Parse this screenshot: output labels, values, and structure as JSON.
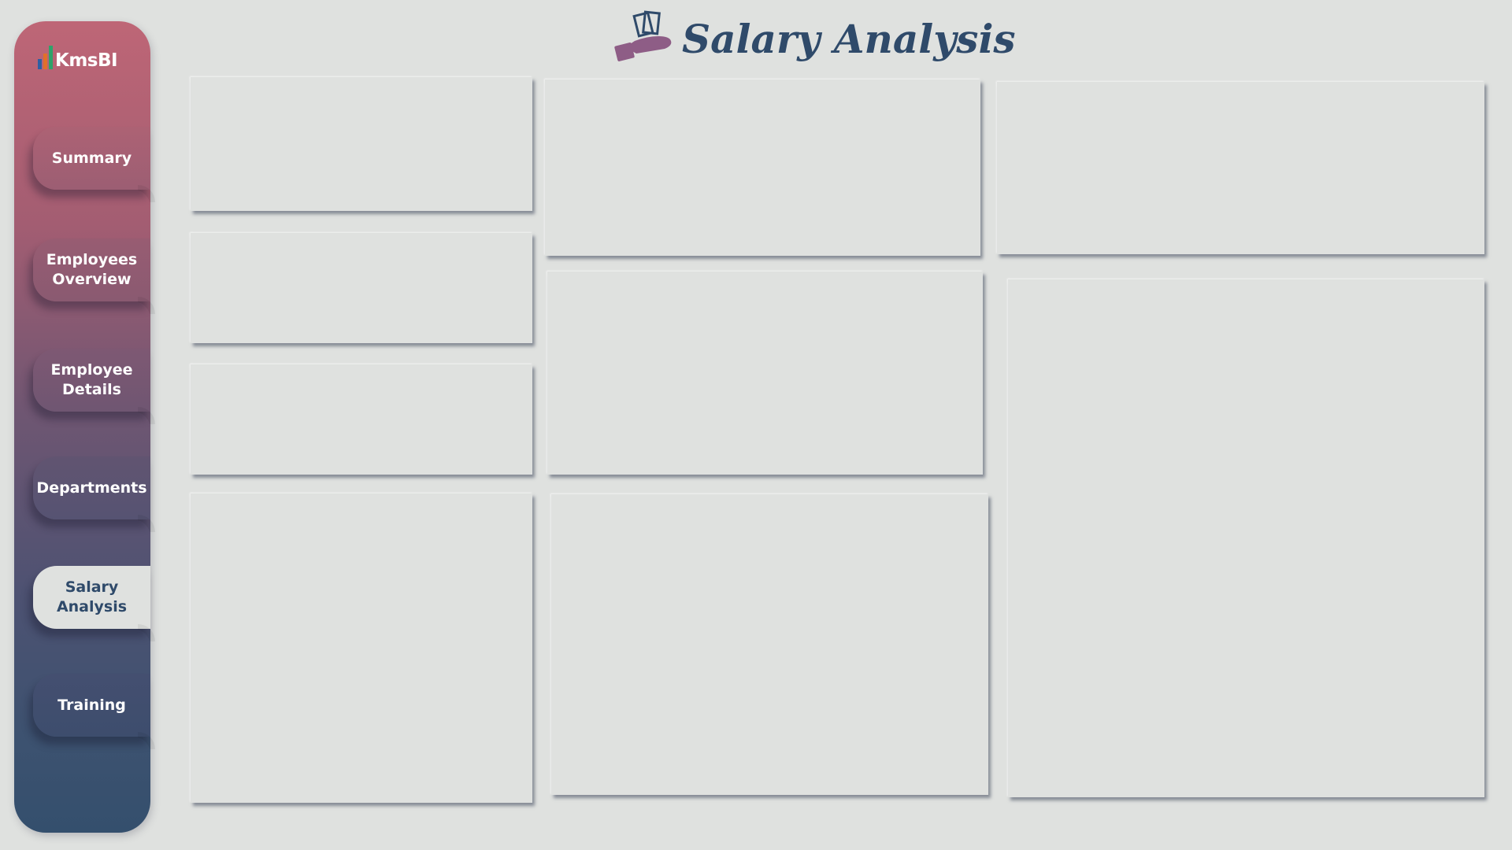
{
  "logo": {
    "text": "KmsBI",
    "bar_colors": [
      "#2e5fa3",
      "#e0702a",
      "#2ea36a"
    ]
  },
  "header": {
    "title": "Salary Analysis",
    "icon": "hand-holding-money-icon"
  },
  "nav": [
    {
      "label": "Summary",
      "active": false
    },
    {
      "label": "Employees\nOverview",
      "active": false
    },
    {
      "label": "Employee\nDetails",
      "active": false
    },
    {
      "label": "Departments",
      "active": false
    },
    {
      "label": "Salary\nAnalysis",
      "active": true
    },
    {
      "label": "Training",
      "active": false
    }
  ],
  "colors": {
    "background": "#dfe1df",
    "title": "#2f4a6a",
    "sidebar_top": "#be6676",
    "sidebar_bottom": "#344f6d",
    "icon_purple": "#8e5d86"
  }
}
